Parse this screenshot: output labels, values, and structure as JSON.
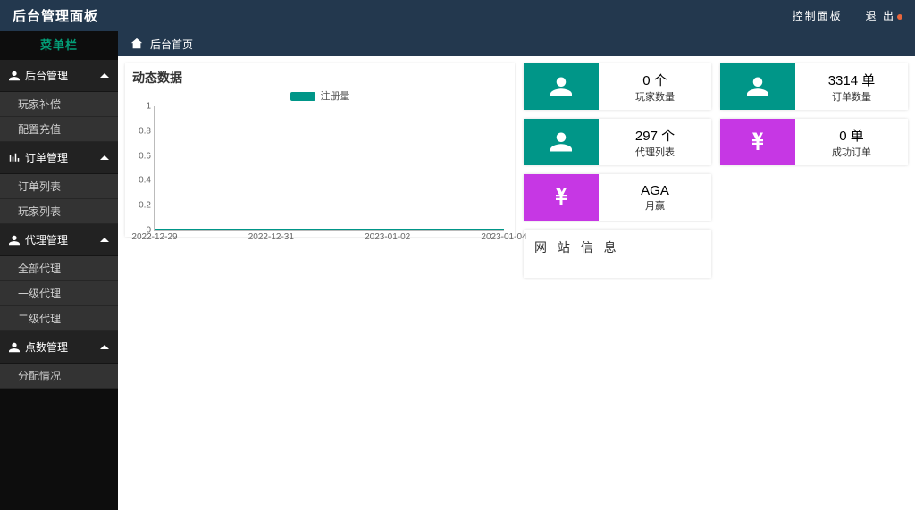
{
  "topbar": {
    "brand": "后台管理面板",
    "dashboard_link": "控制面板",
    "logout": "退 出"
  },
  "sidebar": {
    "title": "菜单栏",
    "groups": [
      {
        "label": "后台管理",
        "icon": "user",
        "items": [
          "玩家补偿",
          "配置充值"
        ]
      },
      {
        "label": "订单管理",
        "icon": "bars",
        "items": [
          "订单列表",
          "玩家列表"
        ]
      },
      {
        "label": "代理管理",
        "icon": "user",
        "items": [
          "全部代理",
          "一级代理",
          "二级代理"
        ]
      },
      {
        "label": "点数管理",
        "icon": "user",
        "items": [
          "分配情况"
        ]
      }
    ]
  },
  "breadcrumb": {
    "page": "后台首页"
  },
  "chart_data": {
    "type": "line",
    "title": "动态数据",
    "legend": "注册量",
    "ylabel": "",
    "xlabel": "",
    "ylim": [
      0,
      1
    ],
    "yticks": [
      0,
      0.2,
      0.4,
      0.6,
      0.8,
      1
    ],
    "categories": [
      "2022-12-29",
      "2022-12-31",
      "2023-01-02",
      "2023-01-04"
    ],
    "series": [
      {
        "name": "注册量",
        "color": "#009688",
        "values": [
          0,
          0,
          0,
          0
        ]
      }
    ]
  },
  "tiles": [
    {
      "icon": "user",
      "color": "teal",
      "value": "0 个",
      "label": "玩家数量"
    },
    {
      "icon": "user",
      "color": "teal",
      "value": "3314 单",
      "label": "订单数量"
    },
    {
      "icon": "user",
      "color": "teal",
      "value": "297 个",
      "label": "代理列表"
    },
    {
      "icon": "yen",
      "color": "purple",
      "value": "0 单",
      "label": "成功订单"
    },
    {
      "icon": "yen",
      "color": "purple",
      "value": "AGA",
      "label": "月赢"
    }
  ],
  "site_info": {
    "title": "网 站 信 息"
  }
}
